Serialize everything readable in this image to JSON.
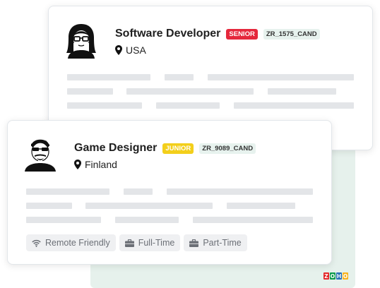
{
  "cards": [
    {
      "title": "Software Developer",
      "level": "SENIOR",
      "code": "ZR_1575_CAND",
      "location": "USA",
      "location_icon": "map-pin-icon",
      "avatar_icon": "female-avatar-icon"
    },
    {
      "title": "Game Designer",
      "level": "JUNIOR",
      "code": "ZR_9089_CAND",
      "location": "Finland",
      "location_icon": "map-pin-icon",
      "avatar_icon": "male-avatar-icon",
      "tags": [
        {
          "label": "Remote Friendly",
          "icon": "wifi-icon"
        },
        {
          "label": "Full-Time",
          "icon": "briefcase-icon"
        },
        {
          "label": "Part-Time",
          "icon": "briefcase-icon"
        }
      ]
    }
  ],
  "logo": {
    "letters": [
      "Z",
      "O",
      "H",
      "O"
    ]
  },
  "colors": {
    "senior_badge": "#e5283c",
    "junior_badge": "#f3cf1b",
    "background_panel": "#e6f1ec",
    "logo": [
      "#e42527",
      "#089949",
      "#226db4",
      "#f9b21d"
    ]
  }
}
